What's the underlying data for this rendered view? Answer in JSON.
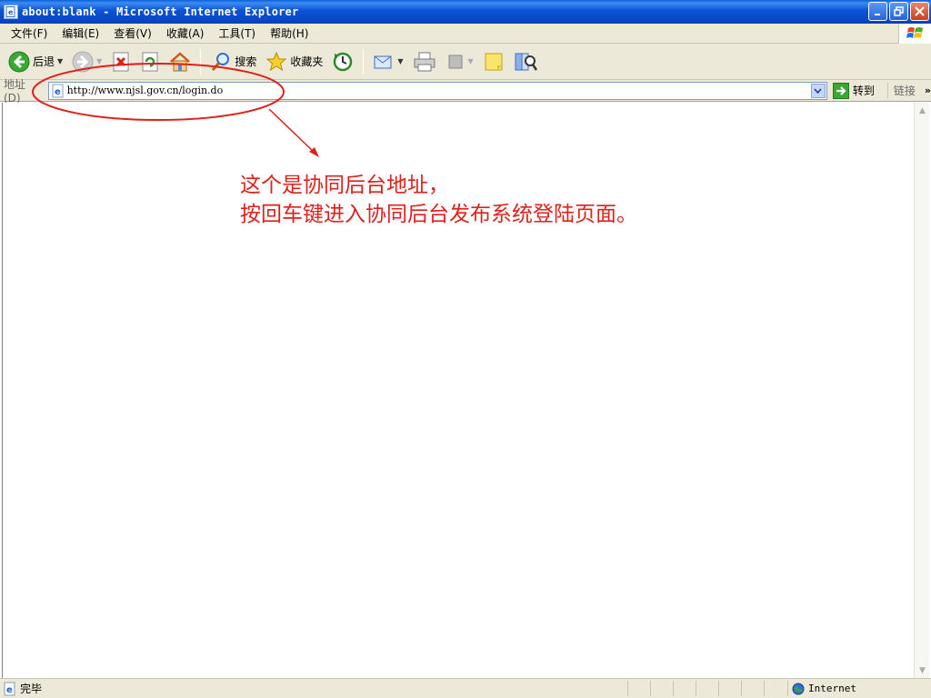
{
  "window": {
    "title": "about:blank - Microsoft Internet Explorer",
    "buttons": [
      "minimize",
      "restore",
      "close"
    ]
  },
  "menubar": {
    "items": [
      {
        "label": "文件(F)"
      },
      {
        "label": "编辑(E)"
      },
      {
        "label": "查看(V)"
      },
      {
        "label": "收藏(A)"
      },
      {
        "label": "工具(T)"
      },
      {
        "label": "帮助(H)"
      }
    ]
  },
  "toolbar": {
    "back_label": "后退",
    "search_label": "搜索",
    "favorites_label": "收藏夹"
  },
  "addressbar": {
    "label": "地址(D)",
    "url": "http://www.njsl.gov.cn/login.do",
    "go_label": "转到",
    "links_label": "链接"
  },
  "annotation": {
    "line1": "这个是协同后台地址，",
    "line2": "按回车键进入协同后台发布系统登陆页面。",
    "color": "#e0201b"
  },
  "statusbar": {
    "text": "完毕",
    "zone": "Internet"
  }
}
